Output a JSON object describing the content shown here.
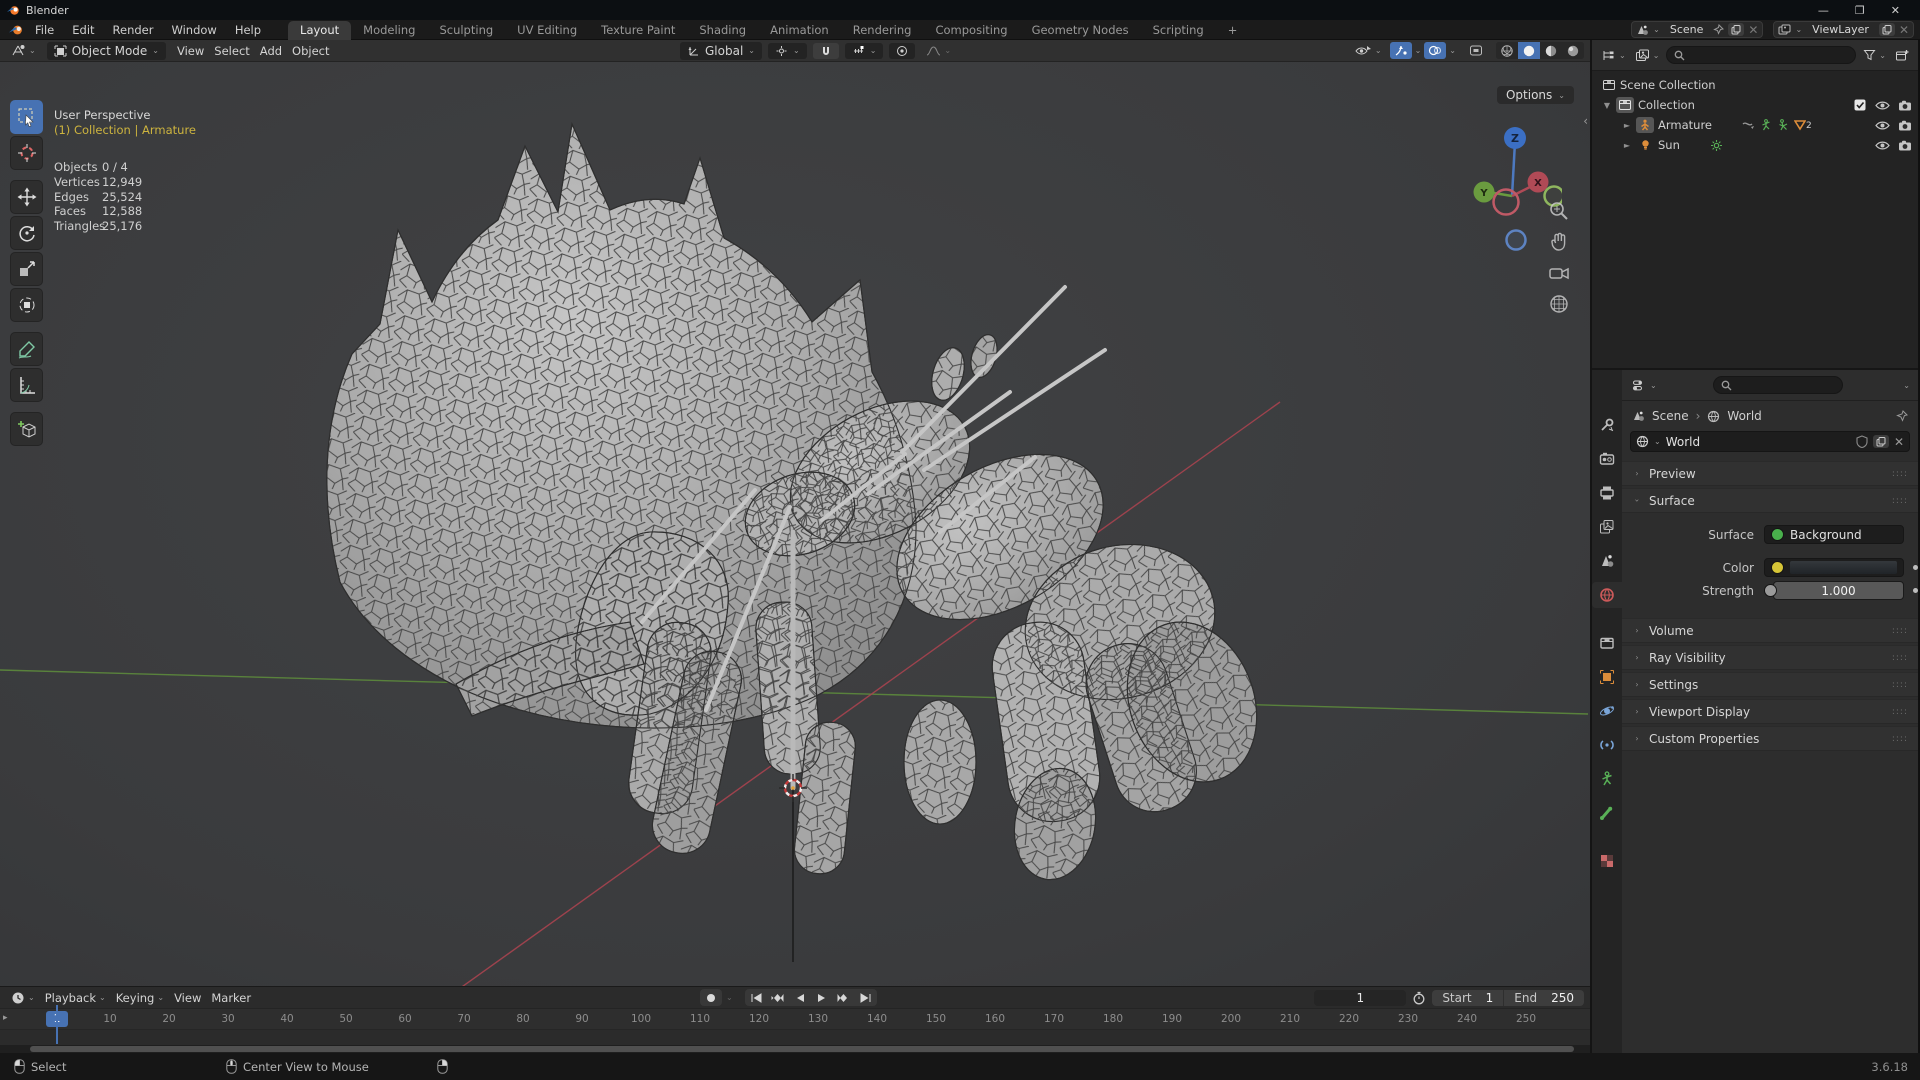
{
  "window": {
    "title": "Blender",
    "version": "3.6.18"
  },
  "topbar": {
    "menus": [
      "File",
      "Edit",
      "Render",
      "Window",
      "Help"
    ],
    "workspaces": [
      "Layout",
      "Modeling",
      "Sculpting",
      "UV Editing",
      "Texture Paint",
      "Shading",
      "Animation",
      "Rendering",
      "Compositing",
      "Geometry Nodes",
      "Scripting"
    ],
    "active_workspace": "Layout",
    "add_workspace": "+",
    "scene_selector": {
      "value": "Scene"
    },
    "view_layer_selector": {
      "value": "ViewLayer"
    }
  },
  "viewport_header": {
    "mode": "Object Mode",
    "menus": [
      "View",
      "Select",
      "Add",
      "Object"
    ],
    "orientation": "Global",
    "options_label": "Options"
  },
  "toolbar": {
    "tools": [
      "select-box",
      "cursor",
      "move",
      "rotate",
      "scale",
      "transform",
      "annotate",
      "measure",
      "add-cube"
    ],
    "active_tool": "select-box"
  },
  "viewport": {
    "overlay": {
      "perspective": "User Perspective",
      "context": "(1) Collection | Armature",
      "stats": [
        {
          "label": "Objects",
          "value": "0 / 4"
        },
        {
          "label": "Vertices",
          "value": "12,949"
        },
        {
          "label": "Edges",
          "value": "25,524"
        },
        {
          "label": "Faces",
          "value": "12,588"
        },
        {
          "label": "Triangles",
          "value": "25,176"
        }
      ]
    },
    "gizmo_axes": {
      "x": "X",
      "y": "Y",
      "z": "Z"
    }
  },
  "outliner": {
    "rows": [
      {
        "label": "Scene Collection"
      },
      {
        "label": "Collection"
      },
      {
        "label": "Armature"
      },
      {
        "label": "Sun"
      }
    ],
    "armature_badge_count": "2"
  },
  "properties": {
    "breadcrumb": {
      "scene": "Scene",
      "world": "World"
    },
    "datablock_name": "World",
    "panels": {
      "preview": "Preview",
      "surface": "Surface",
      "volume": "Volume",
      "ray_visibility": "Ray Visibility",
      "settings": "Settings",
      "viewport_display": "Viewport Display",
      "custom_properties": "Custom Properties"
    },
    "surface": {
      "surface_label": "Surface",
      "surface_value": "Background",
      "color_label": "Color",
      "strength_label": "Strength",
      "strength_value": "1.000"
    }
  },
  "timeline": {
    "menus": [
      "Playback",
      "Keying",
      "View",
      "Marker"
    ],
    "current_frame": "1",
    "start_label": "Start",
    "start_value": "1",
    "end_label": "End",
    "end_value": "250",
    "ticks": [
      "10",
      "20",
      "30",
      "40",
      "50",
      "60",
      "70",
      "80",
      "90",
      "100",
      "110",
      "120",
      "130",
      "140",
      "150",
      "160",
      "170",
      "180",
      "190",
      "200",
      "210",
      "220",
      "230",
      "240",
      "250"
    ],
    "tick_start_x": 110,
    "tick_step": 59
  },
  "statusbar": {
    "select_label": "Select",
    "mmb_label": "Center View to Mouse",
    "rmb_label": "",
    "version": "3.6.18"
  },
  "icons": {
    "blender-logo": "orange swirl",
    "chevron-down": "⌄",
    "search": "magnifier",
    "eye": "visibility",
    "camera": "render visibility",
    "checkbox": "collection enable",
    "magnet": "snapping",
    "globe": "world",
    "pin": "pin",
    "copy": "duplicate",
    "close": "✕",
    "mouse-left": "LMB",
    "mouse-middle": "MMB",
    "mouse-right": "RMB"
  },
  "colors": {
    "accent_blue": "#4772b3",
    "context_yellow": "#cdb43f",
    "object_orange": "#dd8d3a",
    "data_green": "#59b157",
    "axis_red": "#a8434f",
    "axis_green": "#5f8f3c",
    "mesh_gray": "#a8a8a8",
    "world_red": "#cc5a5a"
  }
}
